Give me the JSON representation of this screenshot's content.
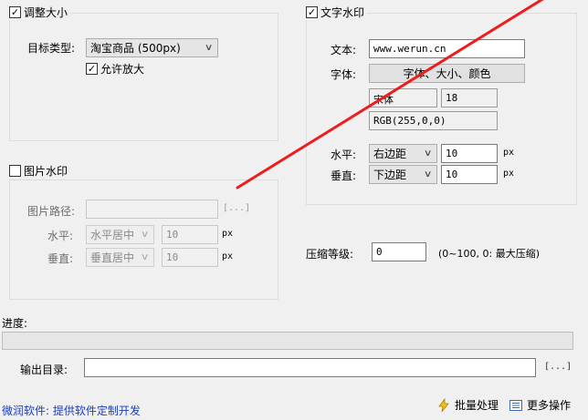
{
  "resize": {
    "checkbox_label": "调整大小",
    "checked": true,
    "target_type_label": "目标类型:",
    "target_type_value": "淘宝商品 (500px)",
    "allow_enlarge_label": "允许放大",
    "allow_enlarge_checked": true
  },
  "text_watermark": {
    "checkbox_label": "文字水印",
    "checked": true,
    "text_label": "文本:",
    "text_value": "www.werun.cn",
    "font_label": "字体:",
    "font_button": "字体、大小、颜色",
    "font_name": "宋体",
    "font_size": "18",
    "font_color": "RGB(255,0,0)",
    "horizontal_label": "水平:",
    "horizontal_value": "右边距",
    "horizontal_offset": "10",
    "vertical_label": "垂直:",
    "vertical_value": "下边距",
    "vertical_offset": "10",
    "unit": "px"
  },
  "image_watermark": {
    "checkbox_label": "图片水印",
    "checked": false,
    "path_label": "图片路径:",
    "path_value": "",
    "browse": "[...]",
    "horizontal_label": "水平:",
    "horizontal_value": "水平居中",
    "horizontal_offset": "10",
    "vertical_label": "垂直:",
    "vertical_value": "垂直居中",
    "vertical_offset": "10",
    "unit": "px"
  },
  "compression": {
    "label": "压缩等级:",
    "value": "0",
    "hint": "(0~100, 0: 最大压缩)"
  },
  "progress": {
    "label": "进度:",
    "value": 0
  },
  "output": {
    "label": "输出目录:",
    "value": "",
    "browse": "[...]"
  },
  "footer": {
    "link": "微润软件: 提供软件定制开发",
    "batch_label": "批量处理",
    "more_label": "更多操作"
  },
  "icons": {
    "check": "check-icon",
    "chevron": "chevron-down-icon",
    "lightning": "lightning-icon",
    "list": "list-icon",
    "arrow": "red-arrow-annotation"
  },
  "colors": {
    "background": "#f0f0f0",
    "annotation_arrow": "#ee1c1c",
    "link": "#1a3dc8"
  }
}
